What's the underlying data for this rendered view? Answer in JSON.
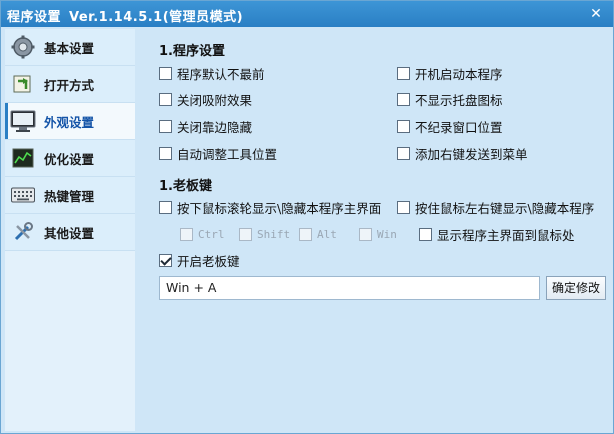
{
  "window": {
    "title": "程序设置",
    "version": "Ver.1.14.5.1(管理员模式)",
    "close_glyph": "✕"
  },
  "sidebar": {
    "items": [
      {
        "label": "基本设置",
        "icon": "gear-icon",
        "active": false
      },
      {
        "label": "打开方式",
        "icon": "open-with-icon",
        "active": false
      },
      {
        "label": "外观设置",
        "icon": "monitor-icon",
        "active": true
      },
      {
        "label": "优化设置",
        "icon": "chart-icon",
        "active": false
      },
      {
        "label": "热键管理",
        "icon": "keyboard-icon",
        "active": false
      },
      {
        "label": "其他设置",
        "icon": "tools-icon",
        "active": false
      }
    ]
  },
  "section1": {
    "title": "1.程序设置",
    "options": [
      {
        "label": "程序默认不最前",
        "checked": false
      },
      {
        "label": "开机启动本程序",
        "checked": false
      },
      {
        "label": "关闭吸附效果",
        "checked": false
      },
      {
        "label": "不显示托盘图标",
        "checked": false
      },
      {
        "label": "关闭靠边隐藏",
        "checked": false
      },
      {
        "label": "不纪录窗口位置",
        "checked": false
      },
      {
        "label": "自动调整工具位置",
        "checked": false
      },
      {
        "label": "添加右键发送到菜单",
        "checked": false
      }
    ]
  },
  "section2": {
    "title": "1.老板键",
    "wheel_toggle": {
      "label": "按下鼠标滚轮显示\\隐藏本程序主界面",
      "checked": false
    },
    "lr_toggle": {
      "label": "按住鼠标左右键显示\\隐藏本程序",
      "checked": false
    },
    "modifiers": [
      {
        "label": "Ctrl",
        "checked": false
      },
      {
        "label": "Shift",
        "checked": false
      },
      {
        "label": "Alt",
        "checked": false
      },
      {
        "label": "Win",
        "checked": false
      }
    ],
    "show_at_mouse": {
      "label": "显示程序主界面到鼠标处",
      "checked": false
    },
    "enable_boss_key": {
      "label": "开启老板键",
      "checked": true
    },
    "hotkey_value": "Win +  A",
    "confirm_label": "确定修改"
  }
}
